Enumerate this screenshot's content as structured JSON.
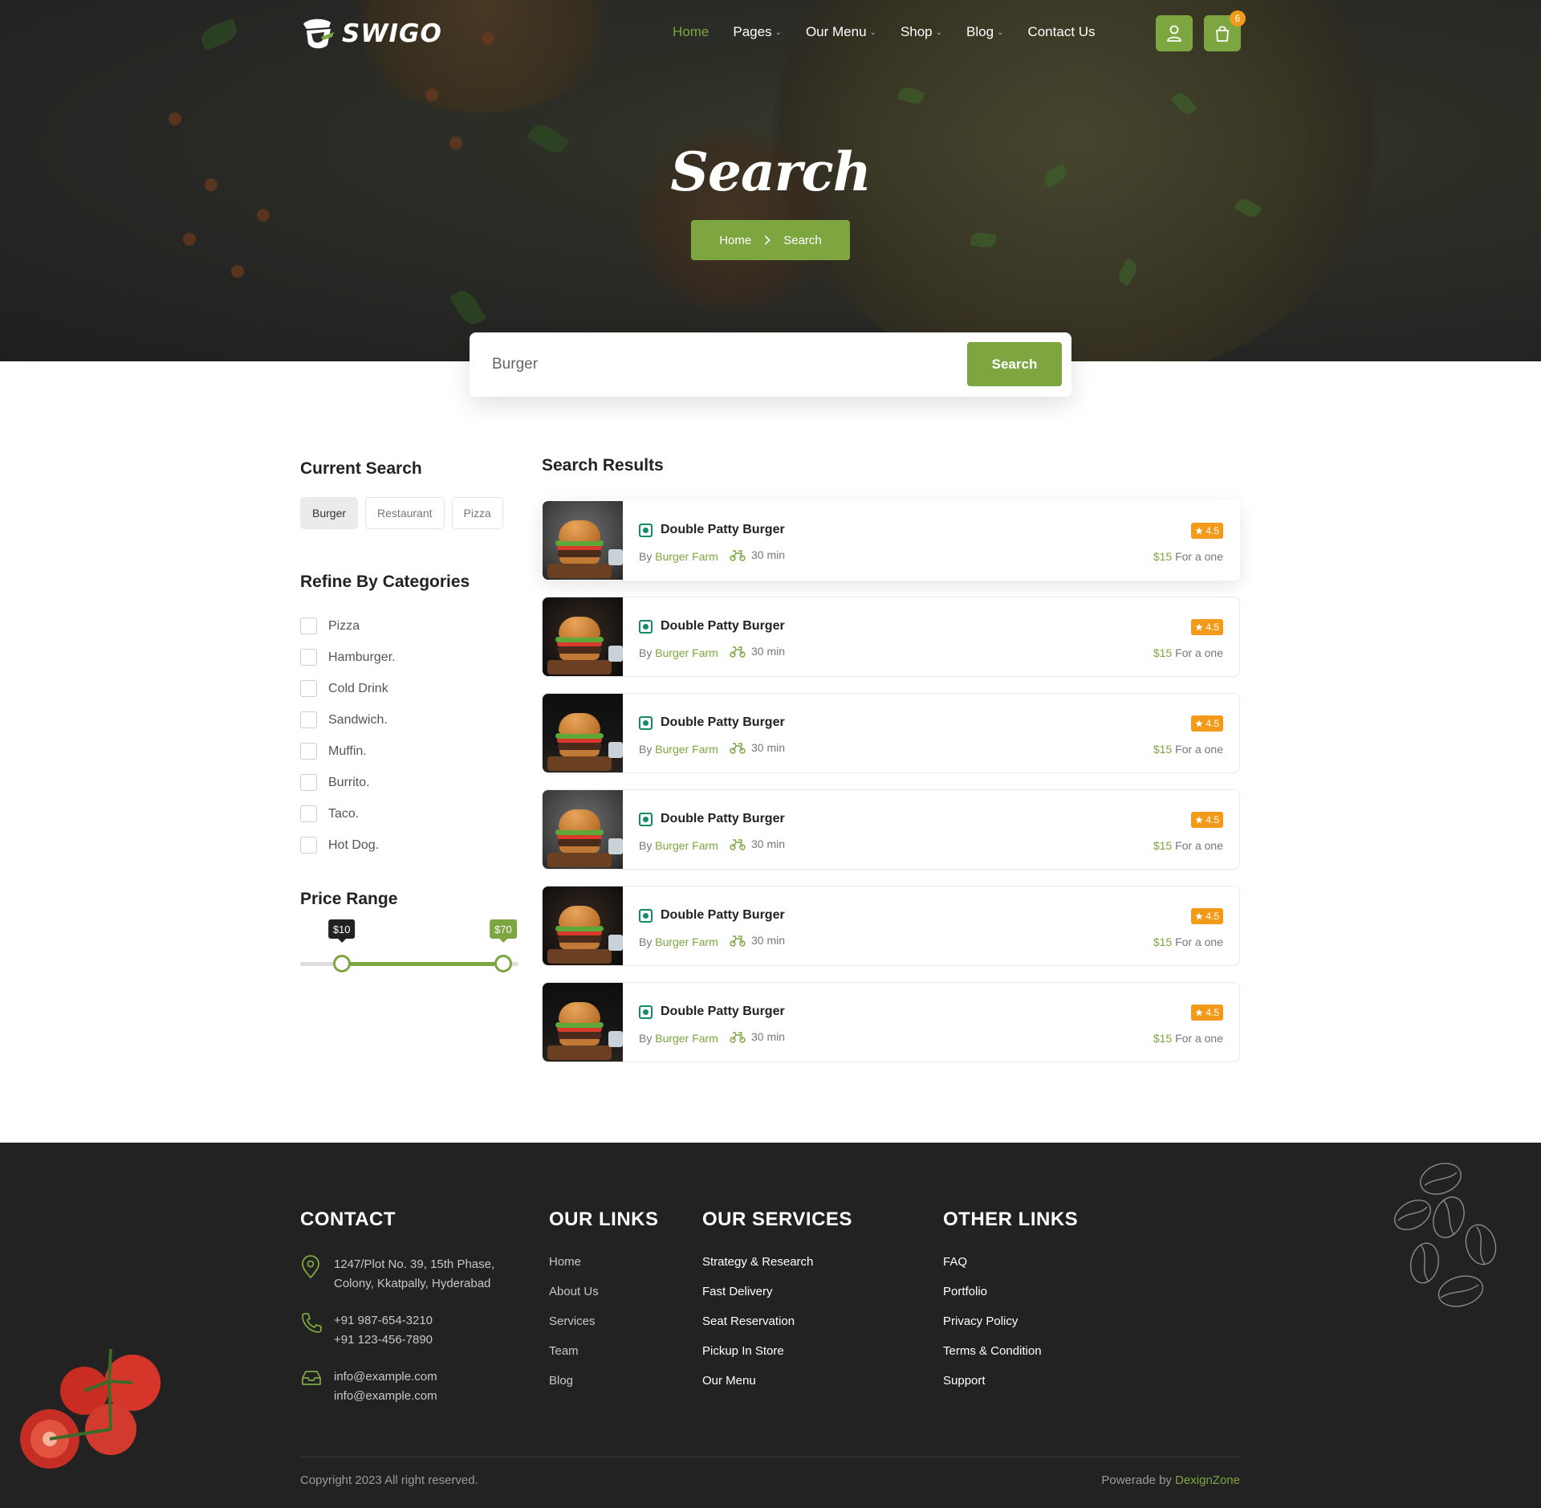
{
  "brand": {
    "name": "SWIGO"
  },
  "nav": {
    "items": [
      {
        "label": "Home",
        "dropdown": false,
        "active": true
      },
      {
        "label": "Pages",
        "dropdown": true,
        "active": false
      },
      {
        "label": "Our Menu",
        "dropdown": true,
        "active": false
      },
      {
        "label": "Shop",
        "dropdown": true,
        "active": false
      },
      {
        "label": "Blog",
        "dropdown": true,
        "active": false
      },
      {
        "label": "Contact Us",
        "dropdown": false,
        "active": false
      }
    ],
    "cart_count": "6"
  },
  "hero": {
    "title": "Search",
    "breadcrumb": {
      "home": "Home",
      "current": "Search"
    }
  },
  "search": {
    "value": "Burger",
    "button_label": "Search"
  },
  "sidebar": {
    "current_search_title": "Current Search",
    "chips": [
      {
        "label": "Burger",
        "selected": true
      },
      {
        "label": "Restaurant",
        "selected": false
      },
      {
        "label": "Pizza",
        "selected": false
      }
    ],
    "categories_title": "Refine By Categories",
    "categories": [
      "Pizza",
      "Hamburger.",
      "Cold Drink",
      "Sandwich.",
      "Muffin.",
      "Burrito.",
      "Taco.",
      "Hot Dog."
    ],
    "price_title": "Price Range",
    "price": {
      "min_label": "$10",
      "max_label": "$70",
      "low_fraction": 0.19,
      "high_fraction": 0.93
    }
  },
  "results": {
    "title": "Search Results",
    "items": [
      {
        "title": "Double Patty Burger",
        "by": "By",
        "restaurant": "Burger Farm",
        "time": "30 min",
        "rating": "4.5",
        "price": "$15",
        "price_note": "For a one",
        "image": "grey"
      },
      {
        "title": "Double Patty Burger",
        "by": "By",
        "restaurant": "Burger Farm",
        "time": "30 min",
        "rating": "4.5",
        "price": "$15",
        "price_note": "For a one",
        "image": "dark"
      },
      {
        "title": "Double Patty Burger",
        "by": "By",
        "restaurant": "Burger Farm",
        "time": "30 min",
        "rating": "4.5",
        "price": "$15",
        "price_note": "For a one",
        "image": "black"
      },
      {
        "title": "Double Patty Burger",
        "by": "By",
        "restaurant": "Burger Farm",
        "time": "30 min",
        "rating": "4.5",
        "price": "$15",
        "price_note": "For a one",
        "image": "grey"
      },
      {
        "title": "Double Patty Burger",
        "by": "By",
        "restaurant": "Burger Farm",
        "time": "30 min",
        "rating": "4.5",
        "price": "$15",
        "price_note": "For a one",
        "image": "dark"
      },
      {
        "title": "Double Patty Burger",
        "by": "By",
        "restaurant": "Burger Farm",
        "time": "30 min",
        "rating": "4.5",
        "price": "$15",
        "price_note": "For a one",
        "image": "black"
      }
    ]
  },
  "footer": {
    "contact": {
      "title": "CONTACT",
      "address_line1": "1247/Plot No. 39, 15th Phase,",
      "address_line2": "Colony, Kkatpally, Hyderabad",
      "phone1": "+91 987-654-3210",
      "phone2": "+91 123-456-7890",
      "email1": "info@example.com",
      "email2": "info@example.com"
    },
    "our_links": {
      "title": "OUR LINKS",
      "items": [
        "Home",
        "About Us",
        "Services",
        "Team",
        "Blog"
      ]
    },
    "our_services": {
      "title": "OUR SERVICES",
      "items": [
        "Strategy & Research",
        "Fast Delivery",
        "Seat Reservation",
        "Pickup In Store",
        "Our Menu"
      ]
    },
    "other_links": {
      "title": "OTHER LINKS",
      "items": [
        "FAQ",
        "Portfolio",
        "Privacy Policy",
        "Terms & Condition",
        "Support"
      ]
    },
    "copyright": "Copyright 2023 All right reserved.",
    "powered_prefix": "Powerade by",
    "powered_brand": "DexignZone"
  },
  "colors": {
    "accent": "#7da640",
    "badge": "#f29a1a",
    "veg": "#138a6b",
    "footer_bg": "#222222"
  },
  "icons": [
    "logo-chef-icon",
    "user-icon",
    "shopping-bag-icon",
    "chevron-right-icon",
    "chevron-down-icon",
    "veg-mark-icon",
    "bike-delivery-icon",
    "star-icon",
    "location-pin-icon",
    "phone-icon",
    "mail-inbox-icon"
  ]
}
